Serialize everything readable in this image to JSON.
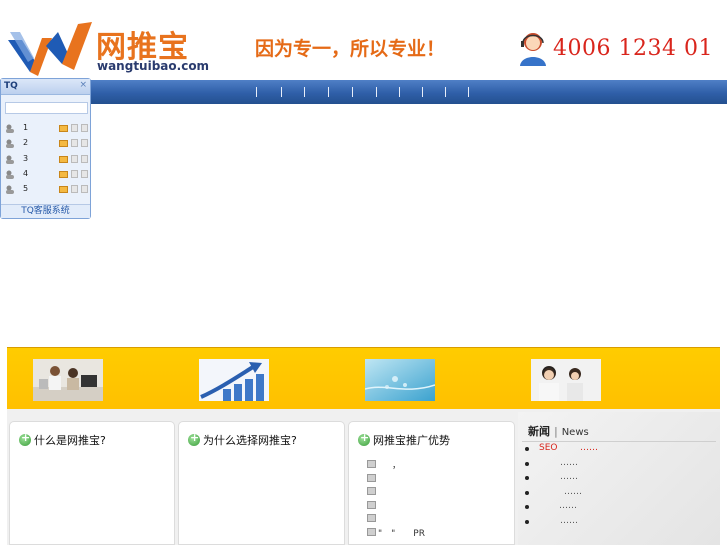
{
  "header": {
    "logo_cn": "网推宝",
    "logo_en": "wangtuibao.com",
    "slogan": "因为专一，所以专业！",
    "hotline": "4006 1234 01"
  },
  "colors": {
    "nav_blue": "#2f5fa8",
    "banner_yellow": "#ffcc00",
    "accent_orange": "#e8731e",
    "hotline_red": "#d9251c"
  },
  "nav": {
    "separator_count": 10
  },
  "tq_widget": {
    "title": "TQ",
    "close_icon": "×",
    "users": [
      {
        "num": "1"
      },
      {
        "num": "2"
      },
      {
        "num": "3"
      },
      {
        "num": "4"
      },
      {
        "num": "5"
      }
    ],
    "footer": "TQ客服系统"
  },
  "banner": {
    "images": [
      "family-computer-photo",
      "growth-chart-arrow",
      "blue-water-abstract",
      "customer-service-headset-photo"
    ]
  },
  "panels": [
    {
      "title": "什么是网推宝?",
      "items": []
    },
    {
      "title": "为什么选择网推宝?",
      "items": []
    },
    {
      "title": "网推宝推广优势",
      "items": [
        {
          "text": "，"
        },
        {
          "text": ""
        },
        {
          "text": ""
        },
        {
          "text": ""
        },
        {
          "text": ""
        },
        {
          "text": "\"　\"　　PR"
        }
      ]
    }
  ],
  "news": {
    "title_cn": "新闻",
    "title_en": "News",
    "items": [
      {
        "title": "SEO",
        "dots": "……"
      },
      {
        "title": "",
        "dots": "……"
      },
      {
        "title": "",
        "dots": "……"
      },
      {
        "title": "",
        "dots": "……"
      },
      {
        "title": "",
        "dots": "……"
      },
      {
        "title": "",
        "dots": "……"
      }
    ]
  }
}
